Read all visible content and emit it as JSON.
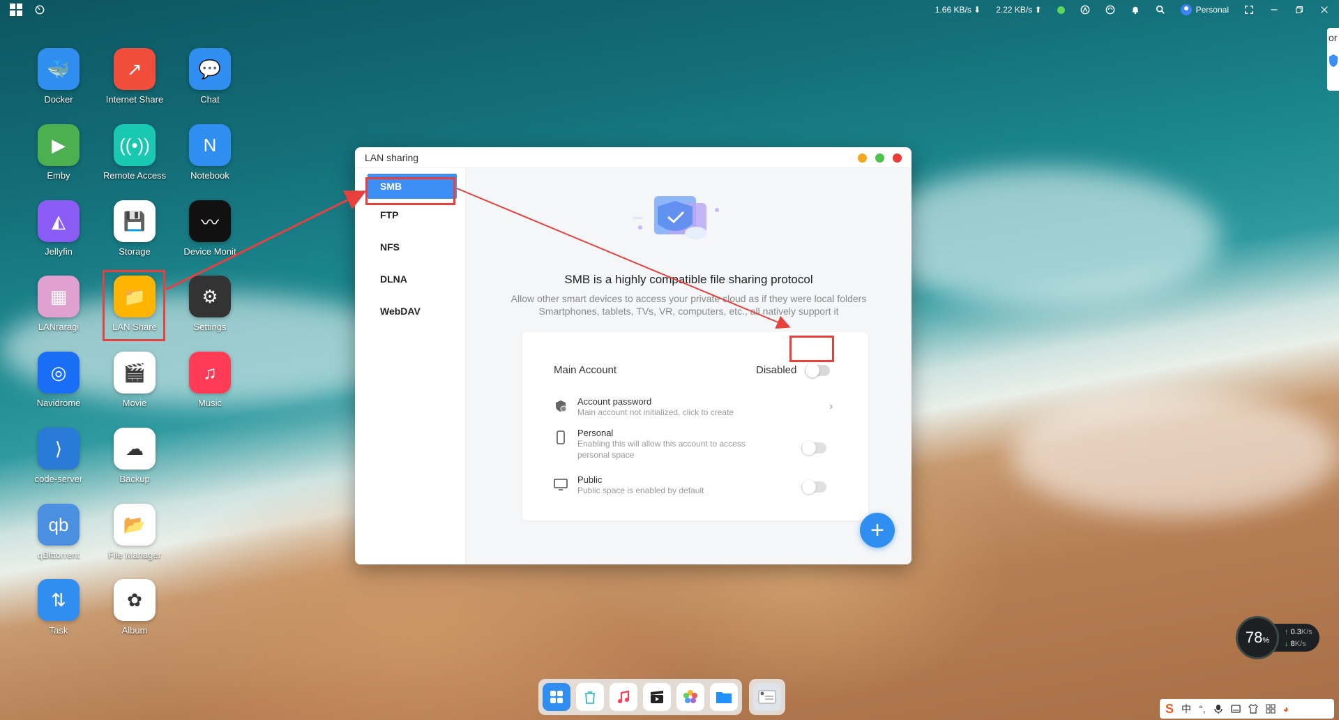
{
  "topbar": {
    "net_down": "1.66 KB/s",
    "net_up": "2.22 KB/s",
    "user": "Personal"
  },
  "desktop": {
    "icons": [
      {
        "label": "Docker",
        "color": "#2f8ef0"
      },
      {
        "label": "Internet Share",
        "color": "#f04d3a"
      },
      {
        "label": "Chat",
        "color": "#2f8ef0"
      },
      {
        "label": "Emby",
        "color": "#4caf50"
      },
      {
        "label": "Remote Access",
        "color": "#19c8b0"
      },
      {
        "label": "Notebook",
        "color": "#2f8ef0"
      },
      {
        "label": "Jellyfin",
        "color": "#8a5cf5"
      },
      {
        "label": "Storage",
        "color": "#ffffff"
      },
      {
        "label": "Device Monit",
        "color": "#111111"
      },
      {
        "label": "LANraragi",
        "color": "#e0a0d0"
      },
      {
        "label": "LAN Share",
        "color": "#ffb400"
      },
      {
        "label": "Settings",
        "color": "#333333"
      },
      {
        "label": "Navidrome",
        "color": "#1a6ef5"
      },
      {
        "label": "Movie",
        "color": "#ffffff"
      },
      {
        "label": "Music",
        "color": "#ff3b55"
      },
      {
        "label": "code-server",
        "color": "#2a7ad8"
      },
      {
        "label": "Backup",
        "color": "#ffffff"
      },
      {
        "label": "qBittorrent",
        "color": "#4b8fe0"
      },
      {
        "label": "File Manager",
        "color": "#ffffff"
      },
      {
        "label": "Task",
        "color": "#2f8ef0"
      },
      {
        "label": "Album",
        "color": "#ffffff"
      }
    ]
  },
  "window": {
    "title": "LAN sharing",
    "tabs": [
      {
        "label": "SMB",
        "active": true
      },
      {
        "label": "FTP",
        "active": false
      },
      {
        "label": "NFS",
        "active": false
      },
      {
        "label": "DLNA",
        "active": false
      },
      {
        "label": "WebDAV",
        "active": false
      }
    ],
    "protocol_title": "SMB is a highly compatible file sharing protocol",
    "protocol_desc_1": "Allow other smart devices to access your private cloud as if they were local folders",
    "protocol_desc_2": "Smartphones, tablets, TVs, VR, computers, etc., all natively support it",
    "main_account_label": "Main Account",
    "main_account_status": "Disabled",
    "main_account_enabled": false,
    "account_password_title": "Account password",
    "account_password_desc": "Main account not initialized, click to create",
    "personal_title": "Personal",
    "personal_desc_1": "Enabling this will allow this account to access",
    "personal_desc_2": "personal space",
    "personal_enabled": false,
    "public_title": "Public",
    "public_desc": "Public space is enabled by default",
    "public_enabled": false,
    "add_symbol": "+"
  },
  "widget": {
    "cpu": "78",
    "cpu_unit": "%",
    "up": "0.3",
    "up_unit": "K/s",
    "down": "8",
    "down_unit": "K/s"
  },
  "ime": {
    "lang": "中"
  },
  "edge_text": "or",
  "accent_color": "#3d8ff5",
  "annotation_color": "#e8403c"
}
